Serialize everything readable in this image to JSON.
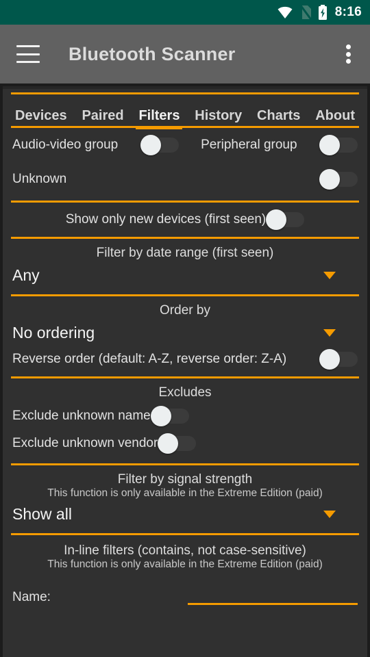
{
  "status_bar": {
    "time": "8:16",
    "icons": [
      "wifi-icon",
      "no-sim-icon",
      "battery-charging-icon"
    ],
    "background_color": "#00574B"
  },
  "app_bar": {
    "title": "Bluetooth Scanner",
    "menu_icon": "hamburger-menu-icon",
    "overflow_icon": "overflow-menu-icon",
    "background_color": "#616161"
  },
  "theme": {
    "accent_color": "#f59b00",
    "content_background": "#303030",
    "text_color": "#e2e2e2"
  },
  "tabs": [
    {
      "label": "Devices",
      "active": false
    },
    {
      "label": "Paired",
      "active": false
    },
    {
      "label": "Filters",
      "active": true
    },
    {
      "label": "History",
      "active": false
    },
    {
      "label": "Charts",
      "active": false
    },
    {
      "label": "About",
      "active": false
    }
  ],
  "filters": {
    "groups": {
      "audio_video": {
        "label": "Audio-video group",
        "state": "off"
      },
      "peripheral": {
        "label": "Peripheral group",
        "state": "off"
      },
      "unknown": {
        "label": "Unknown",
        "state": "off"
      }
    },
    "new_devices": {
      "label": "Show only new devices (first seen)",
      "state": "off"
    },
    "date_range": {
      "heading": "Filter by date range (first seen)",
      "selected": "Any"
    },
    "order_by": {
      "heading": "Order by",
      "selected": "No ordering",
      "reverse": {
        "label": "Reverse order (default: A-Z, reverse order: Z-A)",
        "state": "off"
      }
    },
    "excludes": {
      "heading": "Excludes",
      "unknown_name": {
        "label": "Exclude unknown name",
        "state": "off"
      },
      "unknown_vendor": {
        "label": "Exclude unknown vendor",
        "state": "off"
      }
    },
    "signal_strength": {
      "heading": "Filter by signal strength",
      "note": "This function is only available in the Extreme Edition (paid)",
      "selected": "Show all"
    },
    "inline_filters": {
      "heading": "In-line filters (contains, not case-sensitive)",
      "note": "This function is only available in the Extreme Edition (paid)",
      "name_label": "Name:",
      "name_value": "",
      "name_placeholder": ""
    }
  }
}
